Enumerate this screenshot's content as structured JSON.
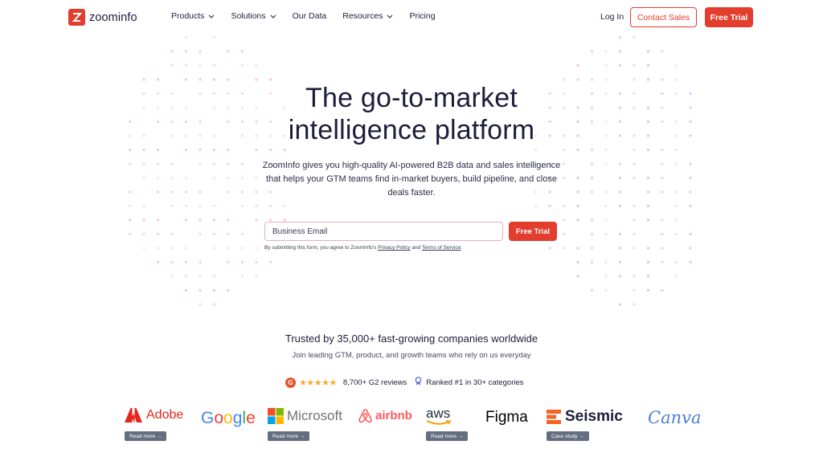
{
  "nav": {
    "logo_text": "zoominfo",
    "menu": [
      {
        "label": "Products",
        "dropdown": true
      },
      {
        "label": "Solutions",
        "dropdown": true
      },
      {
        "label": "Our Data",
        "dropdown": false
      },
      {
        "label": "Resources",
        "dropdown": true
      },
      {
        "label": "Pricing",
        "dropdown": false
      }
    ],
    "login": "Log In",
    "contact_sales": "Contact Sales",
    "free_trial": "Free Trial"
  },
  "hero": {
    "title_line1": "The go-to-market",
    "title_line2": "intelligence platform",
    "subtitle": "ZoomInfo gives you high-quality AI-powered B2B data and sales intelligence that helps your GTM teams find in-market buyers, build pipeline, and close deals faster.",
    "email_placeholder": "Business Email",
    "cta": "Free Trial",
    "legal_prefix": "By submitting this form, you agree to ZoomInfo's ",
    "privacy_link": "Privacy Policy",
    "legal_and": " and ",
    "terms_link": "Terms of Service",
    "legal_suffix": "."
  },
  "trust": {
    "title": "Trusted by 35,000+ fast-growing companies worldwide",
    "subtitle": "Join leading GTM, product, and growth teams who rely on us everyday",
    "g2_badge": "G",
    "stars": "★★★★★",
    "reviews": "8,700+ G2 reviews",
    "ranked": "Ranked #1 in 30+ categories"
  },
  "logos": [
    {
      "name": "Adobe",
      "cta": "Read more →"
    },
    {
      "name": "Google",
      "cta": ""
    },
    {
      "name": "Microsoft",
      "cta": "Read more →"
    },
    {
      "name": "airbnb",
      "cta": ""
    },
    {
      "name": "aws",
      "cta": "Read more →"
    },
    {
      "name": "Figma",
      "cta": ""
    },
    {
      "name": "Seismic",
      "cta": "Case study →"
    },
    {
      "name": "Canva",
      "cta": ""
    }
  ],
  "colors": {
    "brand_red": "#e33d2e",
    "navy": "#1d1d3b",
    "dot_pink": "#f7c6cf",
    "dot_blue": "#c5cdf4"
  }
}
